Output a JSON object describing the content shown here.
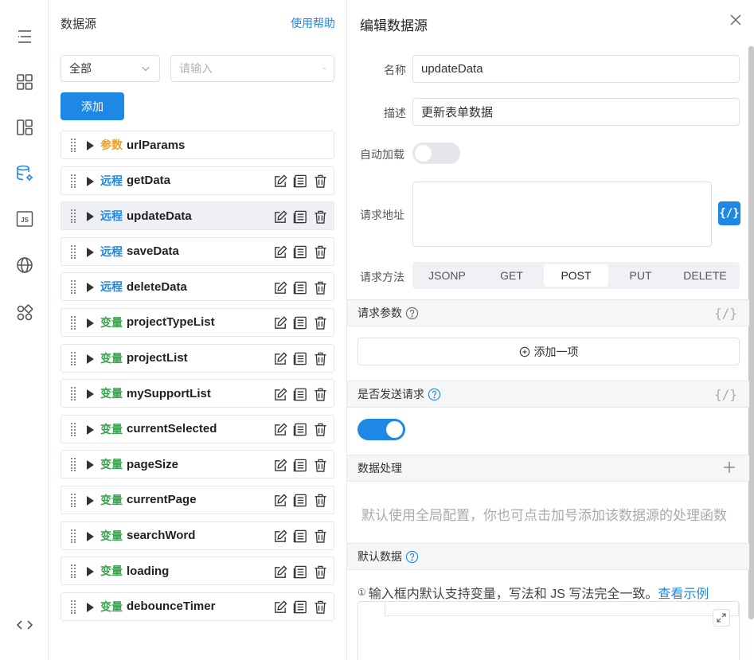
{
  "rail": {
    "icons": [
      "outline-icon",
      "components-icon",
      "layout-icon",
      "datasource-settings-icon",
      "js-icon",
      "globe-icon",
      "apps-icon",
      "code-icon"
    ],
    "js_label": "JS"
  },
  "datasource_panel": {
    "title": "数据源",
    "help_link": "使用帮助",
    "filter_value": "全部",
    "search_placeholder": "请输入",
    "add_button": "添加",
    "items": [
      {
        "type": "param",
        "tag": "参数",
        "name": "urlParams",
        "actions": false,
        "active": false
      },
      {
        "type": "remote",
        "tag": "远程",
        "name": "getData",
        "actions": true,
        "active": false
      },
      {
        "type": "remote",
        "tag": "远程",
        "name": "updateData",
        "actions": true,
        "active": true
      },
      {
        "type": "remote",
        "tag": "远程",
        "name": "saveData",
        "actions": true,
        "active": false
      },
      {
        "type": "remote",
        "tag": "远程",
        "name": "deleteData",
        "actions": true,
        "active": false
      },
      {
        "type": "var",
        "tag": "变量",
        "name": "projectTypeList",
        "actions": true,
        "active": false
      },
      {
        "type": "var",
        "tag": "变量",
        "name": "projectList",
        "actions": true,
        "active": false
      },
      {
        "type": "var",
        "tag": "变量",
        "name": "mySupportList",
        "actions": true,
        "active": false
      },
      {
        "type": "var",
        "tag": "变量",
        "name": "currentSelected",
        "actions": true,
        "active": false
      },
      {
        "type": "var",
        "tag": "变量",
        "name": "pageSize",
        "actions": true,
        "active": false
      },
      {
        "type": "var",
        "tag": "变量",
        "name": "currentPage",
        "actions": true,
        "active": false
      },
      {
        "type": "var",
        "tag": "变量",
        "name": "searchWord",
        "actions": true,
        "active": false
      },
      {
        "type": "var",
        "tag": "变量",
        "name": "loading",
        "actions": true,
        "active": false
      },
      {
        "type": "var",
        "tag": "变量",
        "name": "debounceTimer",
        "actions": true,
        "active": false
      }
    ]
  },
  "editor": {
    "title": "编辑数据源",
    "name_label": "名称",
    "name_value": "updateData",
    "desc_label": "描述",
    "desc_value": "更新表单数据",
    "autoload_label": "自动加载",
    "autoload_on": false,
    "url_label": "请求地址",
    "url_value": "",
    "fx_label": "{/}",
    "method_label": "请求方法",
    "methods": [
      "JSONP",
      "GET",
      "POST",
      "PUT",
      "DELETE"
    ],
    "selected_method": "POST",
    "params_section": "请求参数",
    "params_fx": "{/}",
    "add_item": "添加一项",
    "send_section": "是否发送请求",
    "send_fx": "{/}",
    "send_on": true,
    "process_section": "数据处理",
    "process_hint": "默认使用全局配置，你也可点击加号添加该数据源的处理函数",
    "default_section": "默认数据",
    "info_icon": "①",
    "info_text": "输入框内默认支持变量，写法和 JS 写法完全一致。",
    "info_link": "查看示例"
  },
  "colors": {
    "accent": "#1e88e5",
    "param": "#f0a020",
    "remote": "#1e88e5",
    "var": "#3aa34d"
  }
}
